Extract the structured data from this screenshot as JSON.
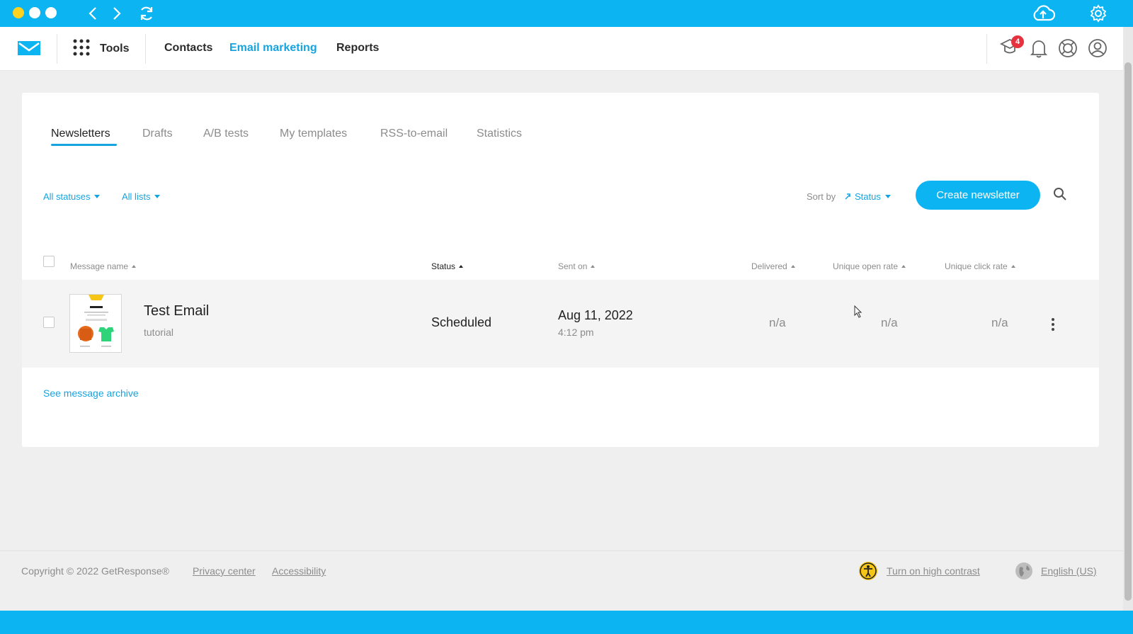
{
  "colors": {
    "accent": "#0db4f2",
    "link": "#16a4df",
    "badge": "#e5323e"
  },
  "browser": {
    "icons": [
      "back-arrow-icon",
      "forward-arrow-icon",
      "reload-icon",
      "cloud-upload-icon",
      "gear-icon"
    ]
  },
  "header": {
    "tools_label": "Tools",
    "nav": [
      {
        "label": "Contacts",
        "active": false
      },
      {
        "label": "Email marketing",
        "active": true
      },
      {
        "label": "Reports",
        "active": false
      }
    ],
    "notification_badge": "4"
  },
  "tabs": [
    {
      "label": "Newsletters",
      "active": true
    },
    {
      "label": "Drafts",
      "active": false
    },
    {
      "label": "A/B tests",
      "active": false
    },
    {
      "label": "My templates",
      "active": false
    },
    {
      "label": "RSS-to-email",
      "active": false
    },
    {
      "label": "Statistics",
      "active": false
    }
  ],
  "filters": {
    "statuses": "All statuses",
    "lists": "All lists"
  },
  "sort": {
    "label": "Sort by",
    "value": "Status"
  },
  "create_button": "Create newsletter",
  "table": {
    "columns": [
      "Message name",
      "Status",
      "Sent on",
      "Delivered",
      "Unique open rate",
      "Unique click rate"
    ],
    "rows": [
      {
        "name": "Test Email",
        "list": "tutorial",
        "status": "Scheduled",
        "sent_date": "Aug 11, 2022",
        "sent_time": "4:12 pm",
        "delivered": "n/a",
        "open_rate": "n/a",
        "click_rate": "n/a"
      }
    ]
  },
  "archive_link": "See message archive",
  "footer": {
    "copyright": "Copyright © 2022 GetResponse®",
    "privacy": "Privacy center",
    "accessibility": "Accessibility",
    "contrast": "Turn on high contrast",
    "language": "English (US)"
  }
}
